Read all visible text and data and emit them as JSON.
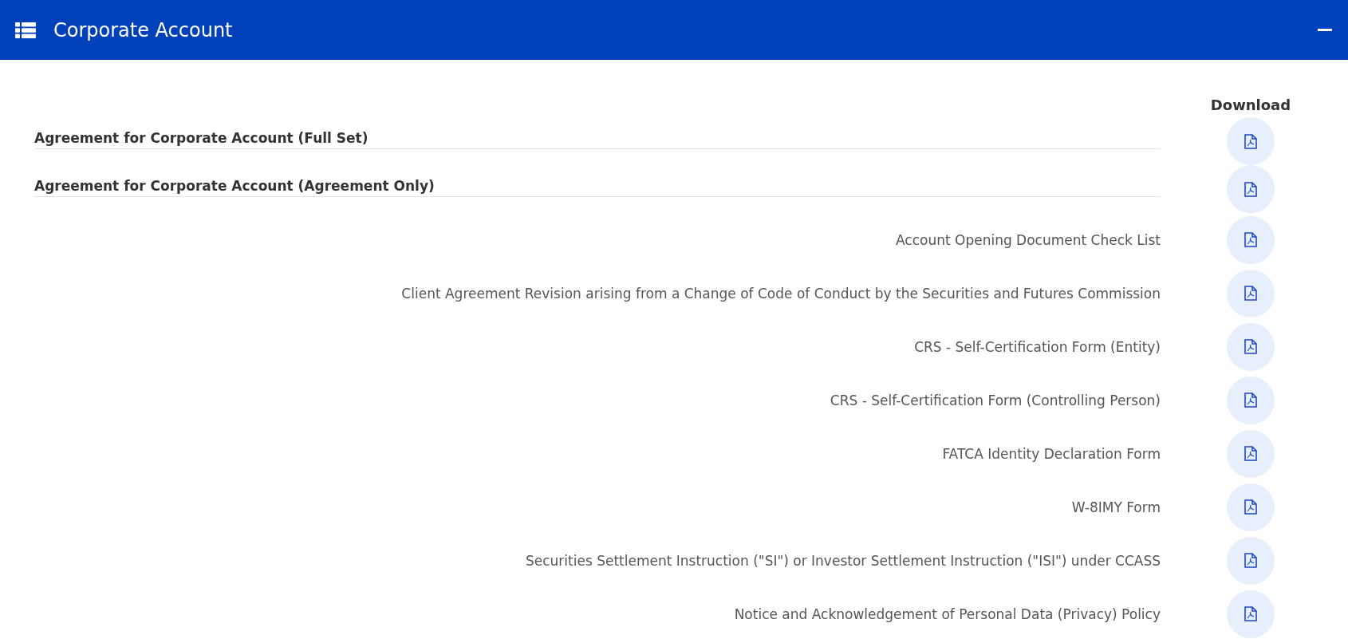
{
  "header": {
    "title": "Corporate Account"
  },
  "download_heading": "Download",
  "documents": [
    {
      "kind": "heading",
      "title": "Agreement for Corporate Account (Full Set)"
    },
    {
      "kind": "heading",
      "title": "Agreement for Corporate Account (Agreement Only)"
    },
    {
      "kind": "item",
      "title": "Account Opening Document Check List"
    },
    {
      "kind": "item",
      "title": "Client Agreement Revision arising from a Change of Code of Conduct by the Securities and Futures Commission"
    },
    {
      "kind": "item",
      "title": "CRS - Self-Certification Form (Entity)"
    },
    {
      "kind": "item",
      "title": "CRS - Self-Certification Form (Controlling Person)"
    },
    {
      "kind": "item",
      "title": "FATCA Identity Declaration Form"
    },
    {
      "kind": "item",
      "title": "W-8IMY Form"
    },
    {
      "kind": "item",
      "title": "Securities Settlement Instruction (\"SI\") or Investor Settlement Instruction (\"ISI\") under CCASS"
    },
    {
      "kind": "item",
      "title": "Notice and Acknowledgement of Personal Data (Privacy) Policy"
    }
  ]
}
